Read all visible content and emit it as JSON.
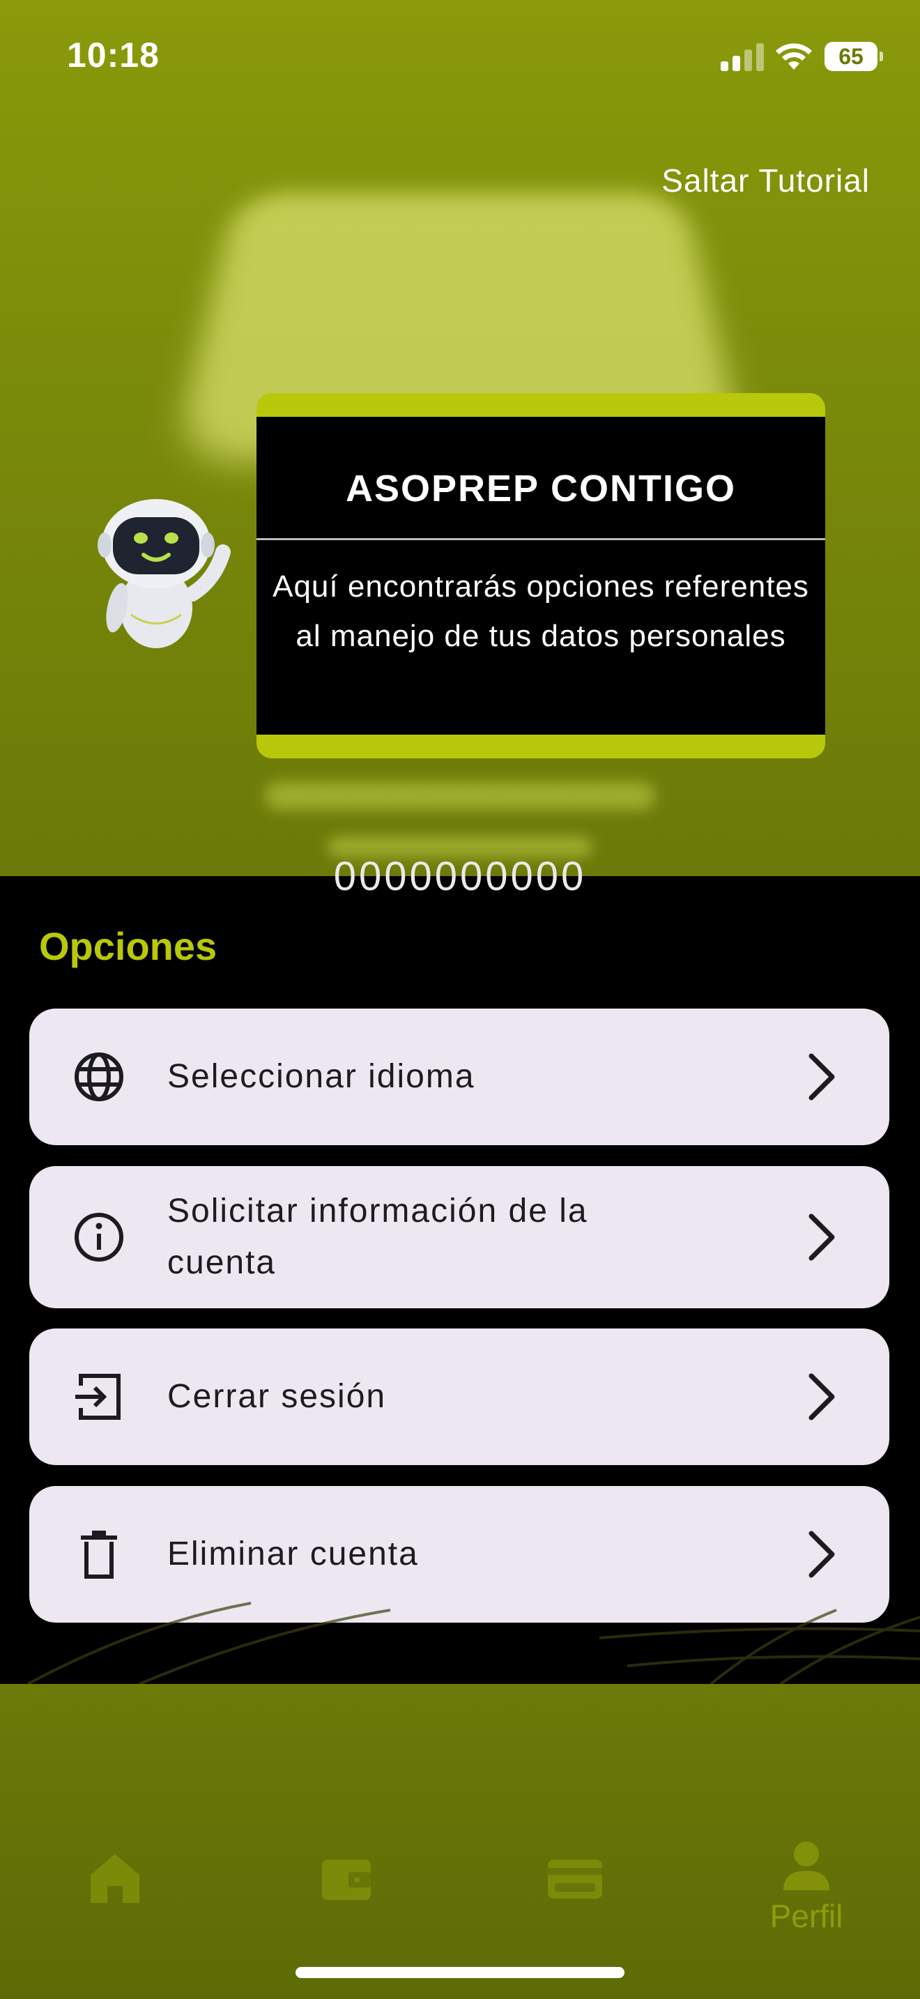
{
  "status_bar": {
    "time": "10:18",
    "battery": "65"
  },
  "tutorial": {
    "skip_label": "Saltar Tutorial",
    "title": "ASOPREP CONTIGO",
    "message": "Aquí encontrarás opciones referentes al manejo de tus datos personales"
  },
  "profile": {
    "account_number": "0000000000"
  },
  "options": {
    "section_title": "Opciones",
    "items": [
      {
        "label": "Seleccionar idioma",
        "icon": "globe-icon"
      },
      {
        "label": "Solicitar información de la cuenta",
        "icon": "info-icon"
      },
      {
        "label": "Cerrar sesión",
        "icon": "logout-icon"
      },
      {
        "label": "Eliminar cuenta",
        "icon": "trash-icon"
      }
    ]
  },
  "bottom_nav": {
    "items": [
      {
        "icon": "home-icon"
      },
      {
        "icon": "wallet-icon"
      },
      {
        "icon": "card-icon"
      },
      {
        "icon": "person-icon",
        "label": "Perfil",
        "active": true
      }
    ]
  },
  "colors": {
    "accent": "#b8c80a",
    "overlay": "#7a8a0a",
    "option_bg": "#ece7f1"
  }
}
